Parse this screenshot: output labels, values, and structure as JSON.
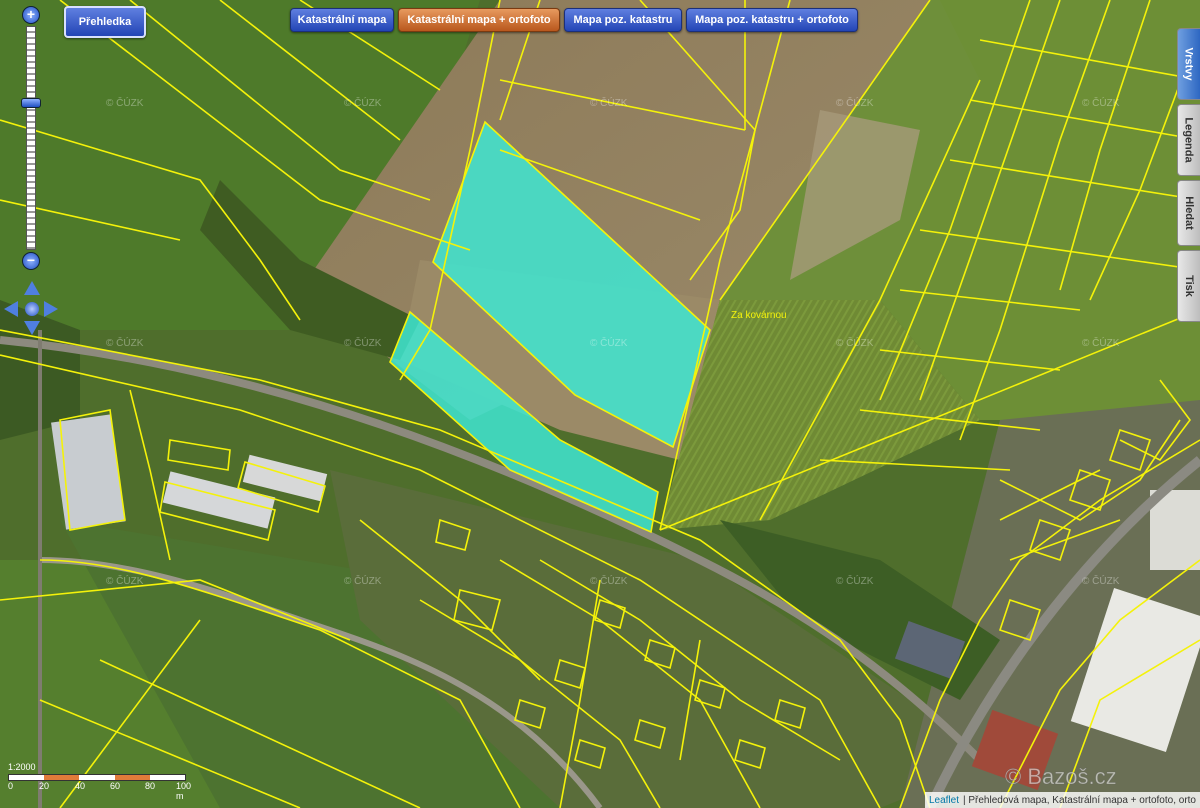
{
  "toolbar": {
    "overview_label": "Přehledka",
    "layers": [
      {
        "label": "Katastrální mapa",
        "active": false
      },
      {
        "label": "Katastrální mapa + ortofoto",
        "active": true
      },
      {
        "label": "Mapa poz. katastru",
        "active": false
      },
      {
        "label": "Mapa poz. katastru + ortofoto",
        "active": false
      }
    ]
  },
  "side_tabs": [
    {
      "label": "Vrstvy",
      "active": true
    },
    {
      "label": "Legenda",
      "active": false
    },
    {
      "label": "Hledat",
      "active": false
    },
    {
      "label": "Tisk",
      "active": false
    }
  ],
  "zoom": {
    "plus": "+",
    "minus": "−"
  },
  "watermark": "© ČÚZK",
  "place_label": "Za kovárnou",
  "scale": {
    "ratio": "1:2000",
    "ticks": [
      "0",
      "20",
      "40",
      "60",
      "80",
      "100 m"
    ]
  },
  "attribution": {
    "link": "Leaflet",
    "text": "| Přehledová mapa, Katastrální mapa + ortofoto, orto"
  },
  "site_watermark": "© Bazoš.cz",
  "colors": {
    "parcel_line": "#f4f20a",
    "highlight": "#3ee6d2",
    "button": "#2345b5",
    "button_active": "#b9571d"
  }
}
